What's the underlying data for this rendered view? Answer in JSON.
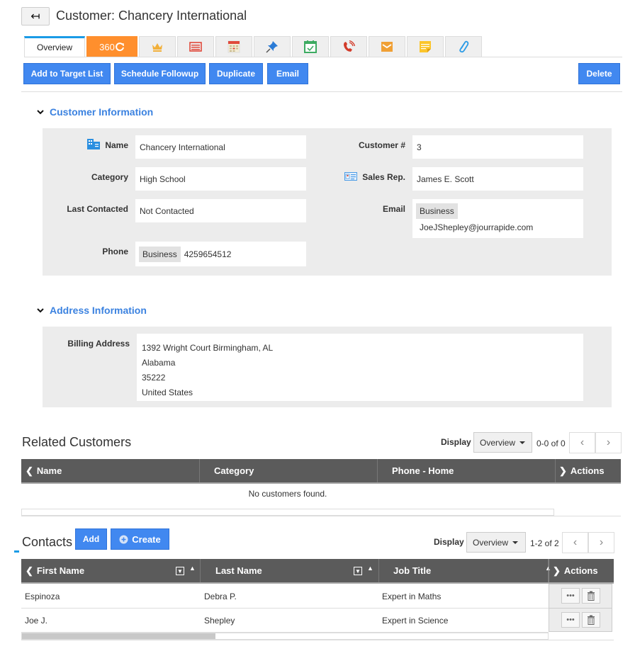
{
  "header": {
    "back_icon": "arrow-left-icon",
    "title": "Customer: Chancery International"
  },
  "tabs": [
    {
      "label": "Overview",
      "icon": null,
      "active": true
    },
    {
      "label": "360",
      "icon": "refresh-icon"
    },
    {
      "label": "",
      "icon": "crown-icon"
    },
    {
      "label": "",
      "icon": "newspaper-icon"
    },
    {
      "label": "",
      "icon": "calendar-icon"
    },
    {
      "label": "",
      "icon": "pin-icon"
    },
    {
      "label": "",
      "icon": "calendar-check-icon"
    },
    {
      "label": "",
      "icon": "phone-call-icon"
    },
    {
      "label": "",
      "icon": "envelope-icon"
    },
    {
      "label": "",
      "icon": "sticky-note-icon"
    },
    {
      "label": "",
      "icon": "paperclip-icon"
    }
  ],
  "toolbar": {
    "add_target": "Add to Target List",
    "schedule": "Schedule Followup",
    "duplicate": "Duplicate",
    "email": "Email",
    "delete": "Delete"
  },
  "customer_info": {
    "title": "Customer Information",
    "name_label": "Name",
    "name": "Chancery International",
    "category_label": "Category",
    "category": "High School",
    "last_contacted_label": "Last Contacted",
    "last_contacted": "Not Contacted",
    "phone_label": "Phone",
    "phone_type": "Business",
    "phone": "4259654512",
    "customer_no_label": "Customer #",
    "customer_no": "3",
    "sales_rep_label": "Sales Rep.",
    "sales_rep": "James E. Scott",
    "email_label": "Email",
    "email_type": "Business",
    "email": "JoeJShepley@jourrapide.com"
  },
  "address_info": {
    "title": "Address Information",
    "billing_label": "Billing Address",
    "lines": [
      "1392 Wright Court Birmingham, AL",
      "Alabama",
      "35222",
      "United States"
    ]
  },
  "related_customers": {
    "title": "Related Customers",
    "display_label": "Display",
    "display_value": "Overview",
    "pager": "0-0 of 0",
    "columns": [
      "Name",
      "Category",
      "Phone - Home",
      "Actions"
    ],
    "empty_text": "No customers found."
  },
  "contacts": {
    "title": "Contacts",
    "add": "Add",
    "create": "Create",
    "display_label": "Display",
    "display_value": "Overview",
    "pager": "1-2 of 2",
    "columns": [
      "First Name",
      "Last Name",
      "Job Title",
      "Actions"
    ],
    "rows": [
      {
        "first": "Espinoza",
        "last": "Debra P.",
        "job": "Expert in Maths"
      },
      {
        "first": "Joe J.",
        "last": "Shepley",
        "job": "Expert in Science"
      }
    ],
    "more_icon": "ellipsis-icon",
    "delete_icon": "trash-icon"
  }
}
